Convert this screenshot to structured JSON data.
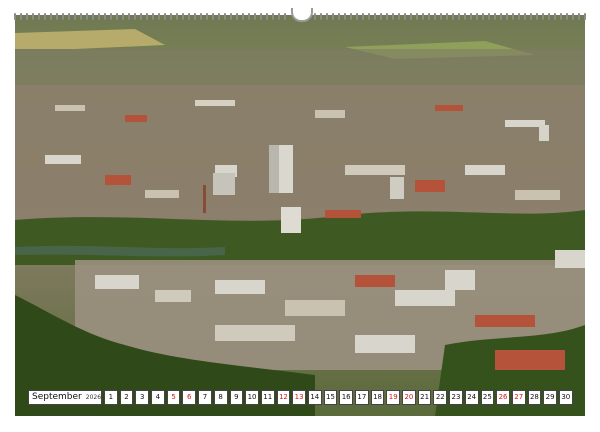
{
  "calendar": {
    "month": "September",
    "year": "2026",
    "days": [
      "1",
      "2",
      "3",
      "4",
      "5",
      "6",
      "7",
      "8",
      "9",
      "10",
      "11",
      "12",
      "13",
      "14",
      "15",
      "16",
      "17",
      "18",
      "19",
      "20",
      "21",
      "22",
      "23",
      "24",
      "25",
      "26",
      "27",
      "28",
      "29",
      "30"
    ],
    "sunday_days": [
      "5",
      "6",
      "12",
      "13",
      "19",
      "20",
      "26",
      "27"
    ],
    "holiday_color": "#d01818"
  },
  "photo": {
    "subject": "aerial-city-view",
    "colors": {
      "forest": "#3f5a22",
      "field": "#9aa05a",
      "roof_red": "#b5523a",
      "building_white": "#d8d6cc"
    }
  }
}
